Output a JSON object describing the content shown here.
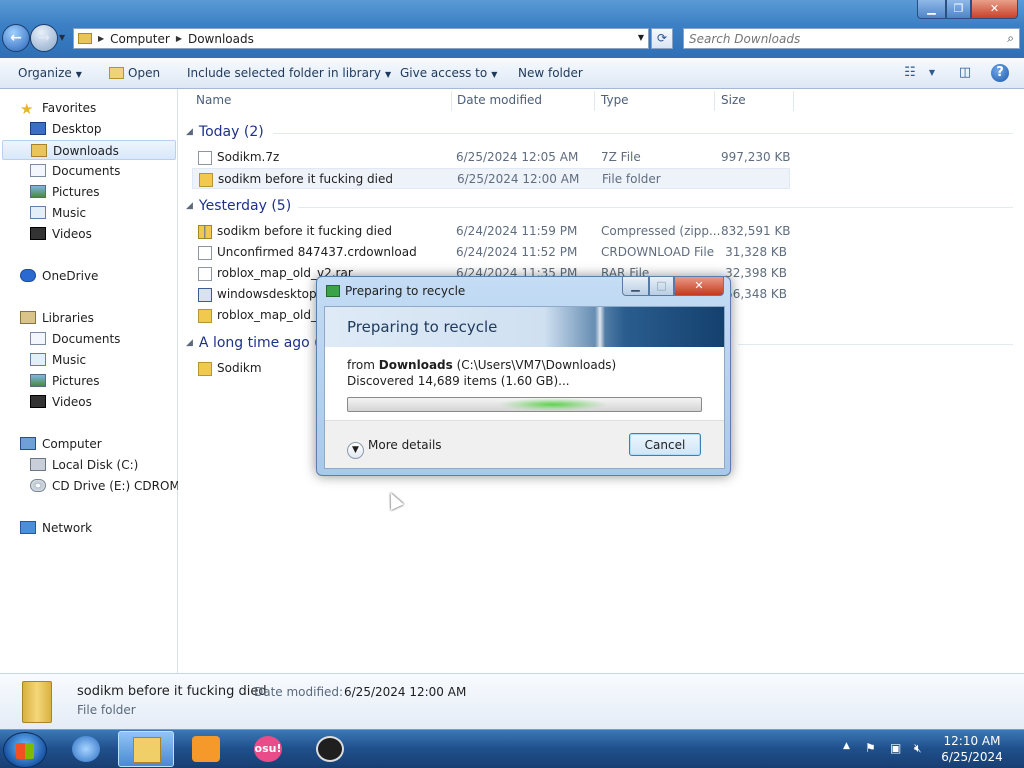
{
  "window": {
    "min_glyph": "▁",
    "max_glyph": "❐",
    "close_glyph": "✕"
  },
  "address": {
    "crumbs": [
      "Computer",
      "Downloads"
    ]
  },
  "search": {
    "placeholder": "Search Downloads"
  },
  "toolbar": {
    "organize": "Organize",
    "open": "Open",
    "include": "Include selected folder in library",
    "share": "Give access to",
    "new_folder": "New folder"
  },
  "nav": {
    "favorites": "Favorites",
    "desktop": "Desktop",
    "downloads": "Downloads",
    "documents": "Documents",
    "pictures": "Pictures",
    "music": "Music",
    "videos": "Videos",
    "onedrive": "OneDrive",
    "libraries": "Libraries",
    "lib_documents": "Documents",
    "lib_music": "Music",
    "lib_pictures": "Pictures",
    "lib_videos": "Videos",
    "computer": "Computer",
    "local_disk": "Local Disk (C:)",
    "cd_drive": "CD Drive (E:) CDROM",
    "network": "Network"
  },
  "columns": {
    "name": "Name",
    "date": "Date modified",
    "type": "Type",
    "size": "Size"
  },
  "groups": {
    "today": "Today (2)",
    "yesterday": "Yesterday (5)",
    "long_ago": "A long time ago ("
  },
  "files": [
    {
      "name": "Sodikm.7z",
      "date": "6/25/2024 12:05 AM",
      "type": "7Z File",
      "size": "997,230 KB",
      "icon": "file-icon"
    },
    {
      "name": "sodikm before it fucking died",
      "date": "6/25/2024 12:00 AM",
      "type": "File folder",
      "size": "",
      "icon": "folder-icon"
    },
    {
      "name": "sodikm before it fucking died",
      "date": "6/24/2024 11:59 PM",
      "type": "Compressed (zipp...",
      "size": "832,591 KB",
      "icon": "zip-folder-icon"
    },
    {
      "name": "Unconfirmed 847437.crdownload",
      "date": "6/24/2024 11:52 PM",
      "type": "CRDOWNLOAD File",
      "size": "31,328 KB",
      "icon": "file-icon"
    },
    {
      "name": "roblox_map_old_v2.rar",
      "date": "6/24/2024 11:35 PM",
      "type": "RAR File",
      "size": "32,398 KB",
      "icon": "file-icon"
    },
    {
      "name": "windowsdesktop-r",
      "date": "",
      "type": "",
      "size": "56,348 KB",
      "icon": "installer-icon"
    },
    {
      "name": "roblox_map_old_v2",
      "date": "",
      "type": "",
      "size": "",
      "icon": "folder-icon"
    },
    {
      "name": "Sodikm",
      "date": "",
      "type": "",
      "size": "",
      "icon": "folder-icon"
    }
  ],
  "details": {
    "name": "sodikm before it fucking died",
    "date_label": "Date modified:",
    "date_value": "6/25/2024 12:00 AM",
    "type": "File folder"
  },
  "dialog": {
    "title": "Preparing to recycle",
    "heading": "Preparing to recycle",
    "from_label": "from",
    "from_folder": "Downloads",
    "from_path": "(C:\\Users\\VM7\\Downloads)",
    "discovered": "Discovered 14,689 items (1.60 GB)...",
    "more_details": "More details",
    "cancel": "Cancel"
  },
  "taskbar": {
    "osu_label": "osu!",
    "clock_time": "12:10 AM",
    "clock_date": "6/25/2024"
  }
}
